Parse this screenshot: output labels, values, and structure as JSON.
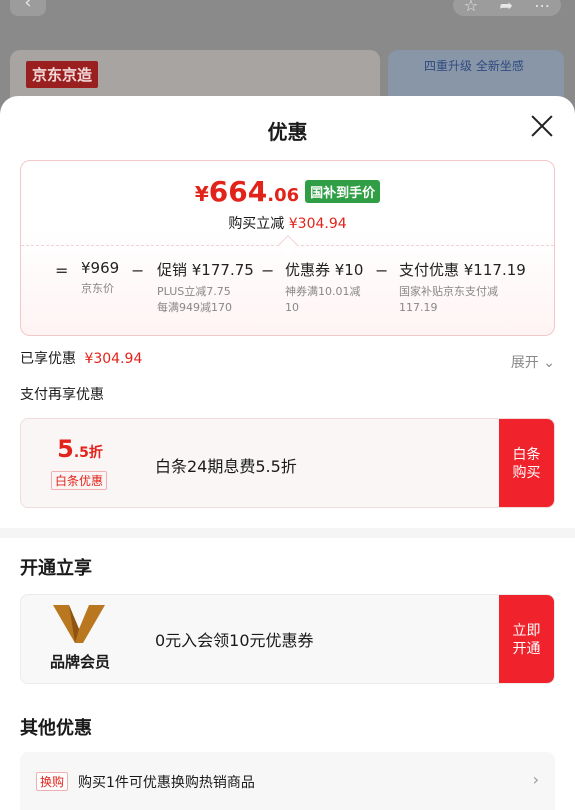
{
  "background": {
    "back_glyph": "‹",
    "icons": [
      "star-icon",
      "share-icon",
      "more-icon"
    ],
    "brand_badge": "京东京造",
    "promo_banner": "四重升级 全新坐感"
  },
  "sheet": {
    "title": "优惠",
    "close_icon": "close-icon"
  },
  "price_box": {
    "final_currency": "¥",
    "final_integer": "664",
    "final_decimal": ".06",
    "final_tag": "国补到手价",
    "reduce_label": "购买立减",
    "reduce_amount": "¥304.94",
    "breakdown": [
      {
        "main": "¥969",
        "sub": "京东价"
      },
      {
        "main": "促销 ¥177.75",
        "sub": "PLUS立减7.75\n每满949减170"
      },
      {
        "main": "优惠券 ¥10",
        "sub": "神券满10.01减\n10"
      },
      {
        "main": "支付优惠 ¥117.19",
        "sub": "国家补贴京东支付减\n117.19"
      }
    ],
    "operators": [
      "=",
      "−",
      "−",
      "−"
    ]
  },
  "enjoyed": {
    "label": "已享优惠",
    "amount": "¥304.94",
    "expand_label": "展开",
    "expand_icon": "chevron-down-icon"
  },
  "pay_again_label": "支付再享优惠",
  "baitiao": {
    "rate_big": "5",
    "rate_small": ".5折",
    "tag": "白条优惠",
    "desc": "白条24期息费5.5折",
    "button_line1": "白条",
    "button_line2": "购买"
  },
  "open_section": {
    "heading": "开通立享",
    "logo_icon": "brand-member-v-icon",
    "label": "品牌会员",
    "desc": "0元入会领10元优惠券",
    "button_line1": "立即",
    "button_line2": "开通",
    "accent": "#b9771f"
  },
  "other_section": {
    "heading": "其他优惠",
    "tag": "换购",
    "text": "购买1件可优惠换购热销商品",
    "chevron_icon": "chevron-right-icon"
  },
  "colors": {
    "accent_red": "#e2231a",
    "button_red": "#f0232d",
    "gov_green": "#2f9e44"
  }
}
